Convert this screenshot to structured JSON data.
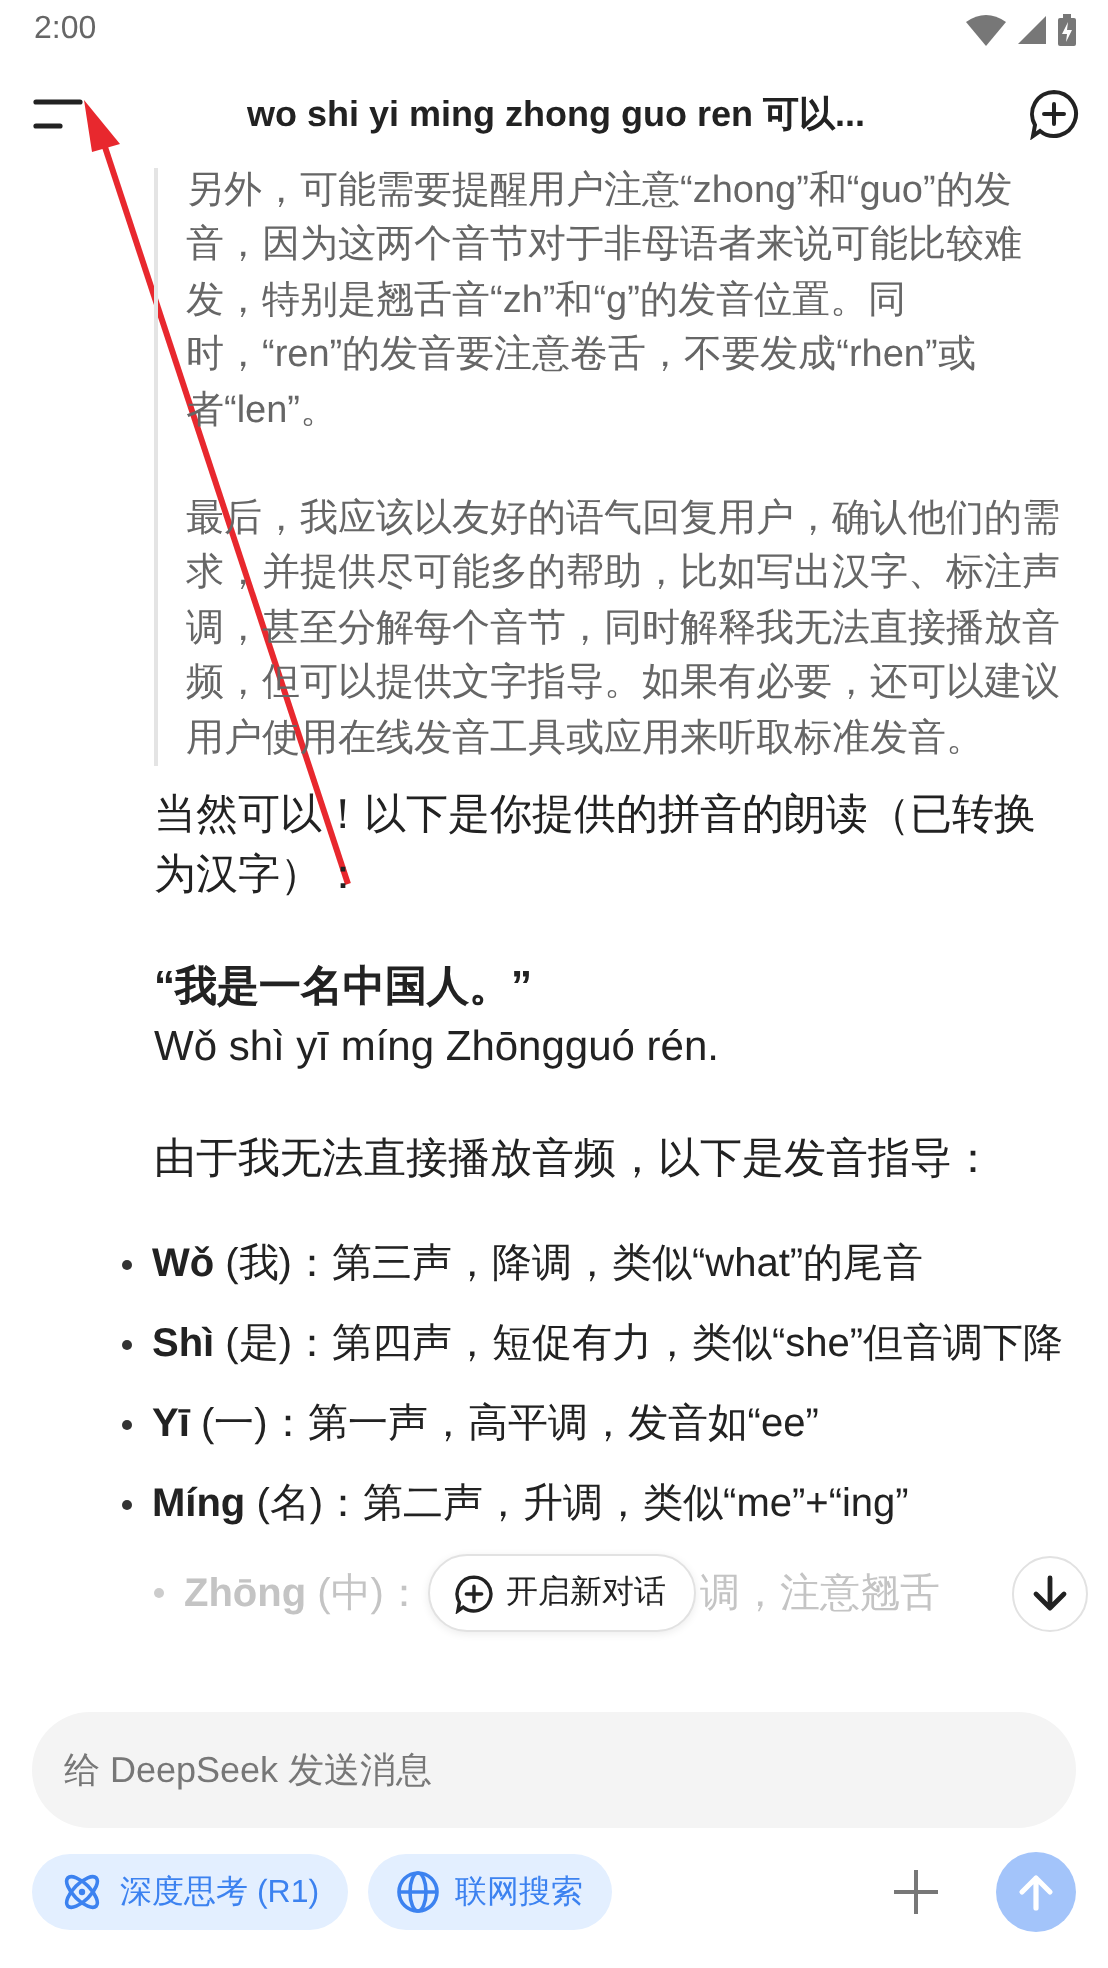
{
  "status_bar": {
    "time": "2:00"
  },
  "header": {
    "title": "wo shi yi ming zhong guo ren 可以..."
  },
  "reasoning": [
    "另外，可能需要提醒用户注意“zhong”和“guo”的发音，因为这两个音节对于非母语者来说可能比较难发，特别是翘舌音“zh”和“g”的发音位置。同时，“ren”的发音要注意卷舌，不要发成“rhen”或者“len”。",
    "最后，我应该以友好的语气回复用户，确认他们的需求，并提供尽可能多的帮助，比如写出汉字、标注声调，甚至分解每个音节，同时解释我无法直接播放音频，但可以提供文字指导。如果有必要，还可以建议用户使用在线发音工具或应用来听取标准发音。"
  ],
  "answer": {
    "intro": "当然可以！以下是你提供的拼音的朗读（已转换为汉字）：",
    "quote": "“我是一名中国人。”",
    "pinyin": "Wǒ shì yī míng Zhōngguó rén.",
    "guide_intro": "由于我无法直接播放音频，以下是发音指导：",
    "bullets": [
      {
        "term": "Wǒ",
        "text": "(我)：第三声，降调，类似“what”的尾音"
      },
      {
        "term": "Shì",
        "text": "(是)：第四声，短促有力，类似“she”但音调下降"
      },
      {
        "term": "Yī",
        "text": "(一)：第一声，高平调，发音如“ee”"
      },
      {
        "term": "Míng",
        "text": "(名)：第二声，升调，类似“me”+“ing”"
      }
    ],
    "last_bullet": {
      "term": "Zhōng",
      "text": "(中)：",
      "tail": "调，注意翘舌"
    }
  },
  "new_chat_button": {
    "label": "开启新对话"
  },
  "composer": {
    "placeholder": "给 DeepSeek 发送消息"
  },
  "chips": [
    {
      "label": "深度思考 (R1)",
      "kind": "atom",
      "selected": false
    },
    {
      "label": "联网搜索",
      "kind": "globe",
      "selected": false
    }
  ]
}
